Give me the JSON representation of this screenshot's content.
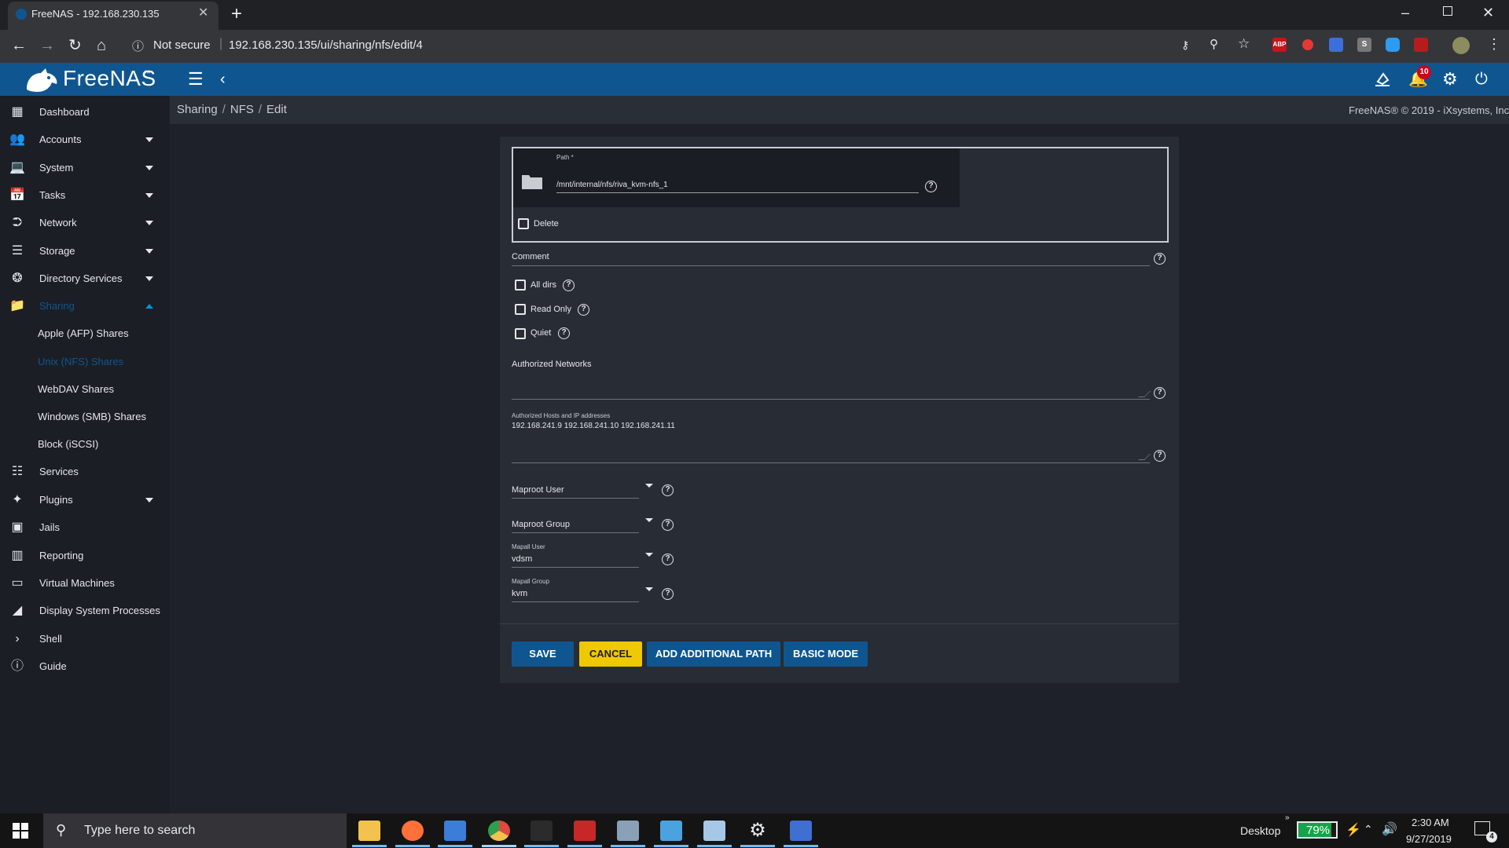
{
  "browser": {
    "tab_title": "FreeNAS - 192.168.230.135",
    "tab_close": "✕",
    "new_tab": "+",
    "not_secure": "Not secure",
    "url": "192.168.230.135/ui/sharing/nfs/edit/4",
    "extensions": [
      "key-icon",
      "zoom-icon",
      "star-icon",
      "abp-icon",
      "shield-icon",
      "translate-icon",
      "s-icon",
      "cloud-icon",
      "pdf-icon",
      "avatar-icon",
      "menu-icon"
    ],
    "abp_label": "ABP"
  },
  "app": {
    "name": "FreeNAS",
    "trademark": "™",
    "notification_count": "10",
    "colors": {
      "header": "#0f5691",
      "sidebar": "#1b1e25",
      "card": "#282c35",
      "save": "#0f5691",
      "cancel": "#f0c800"
    }
  },
  "sidebar": {
    "items": [
      {
        "label": "Dashboard",
        "icon": "dashboard-icon",
        "caret": false
      },
      {
        "label": "Accounts",
        "icon": "accounts-icon",
        "caret": true
      },
      {
        "label": "System",
        "icon": "system-icon",
        "caret": true
      },
      {
        "label": "Tasks",
        "icon": "tasks-icon",
        "caret": true
      },
      {
        "label": "Network",
        "icon": "network-icon",
        "caret": true
      },
      {
        "label": "Storage",
        "icon": "storage-icon",
        "caret": true
      },
      {
        "label": "Directory Services",
        "icon": "directory-services-icon",
        "caret": true
      },
      {
        "label": "Sharing",
        "icon": "sharing-icon",
        "caret": true,
        "expanded": true
      },
      {
        "label": "Services",
        "icon": "services-icon",
        "caret": false
      },
      {
        "label": "Plugins",
        "icon": "plugins-icon",
        "caret": true
      },
      {
        "label": "Jails",
        "icon": "jails-icon",
        "caret": false
      },
      {
        "label": "Reporting",
        "icon": "reporting-icon",
        "caret": false
      },
      {
        "label": "Virtual Machines",
        "icon": "virtual-machines-icon",
        "caret": false
      },
      {
        "label": "Display System Processes",
        "icon": "processes-icon",
        "caret": false
      },
      {
        "label": "Shell",
        "icon": "shell-icon",
        "caret": false
      },
      {
        "label": "Guide",
        "icon": "guide-icon",
        "caret": false
      }
    ],
    "sharing_sub": [
      {
        "label": "Apple (AFP) Shares"
      },
      {
        "label": "Unix (NFS) Shares",
        "active": true
      },
      {
        "label": "WebDAV Shares"
      },
      {
        "label": "Windows (SMB) Shares"
      },
      {
        "label": "Block (iSCSI)"
      }
    ]
  },
  "breadcrumb": {
    "items": [
      "Sharing",
      "NFS",
      "Edit"
    ],
    "separator": "/"
  },
  "copyright": "FreeNAS® © 2019 - iXsystems, Inc.",
  "form": {
    "path_label": "Path *",
    "path_value": "/mnt/internal/nfs/riva_kvm-nfs_1",
    "delete_label": "Delete",
    "comment_label": "Comment",
    "all_dirs_label": "All dirs",
    "read_only_label": "Read Only",
    "quiet_label": "Quiet",
    "authorized_networks_label": "Authorized Networks",
    "authorized_hosts_label": "Authorized Hosts and IP addresses",
    "authorized_hosts_value": "192.168.241.9 192.168.241.10 192.168.241.11",
    "maproot_user_label": "Maproot User",
    "maproot_group_label": "Maproot Group",
    "mapall_user_label": "Mapall User",
    "mapall_user_value": "vdsm",
    "mapall_group_label": "Mapall Group",
    "mapall_group_value": "kvm",
    "help_glyph": "?",
    "buttons": {
      "save": "SAVE",
      "cancel": "CANCEL",
      "add_path": "ADD ADDITIONAL PATH",
      "basic_mode": "BASIC MODE"
    }
  },
  "taskbar": {
    "search_placeholder": "Type here to search",
    "desktop_label": "Desktop",
    "battery": "79%",
    "time": "2:30 AM",
    "date": "9/27/2019",
    "notification_count": "4",
    "apps": [
      "file-explorer-icon",
      "firefox-icon",
      "network-app-icon",
      "chrome-icon",
      "terminal-icon",
      "app-red-icon",
      "files-icon",
      "remote-desktop-icon",
      "notepad-icon",
      "settings-icon",
      "user-app-icon"
    ]
  }
}
